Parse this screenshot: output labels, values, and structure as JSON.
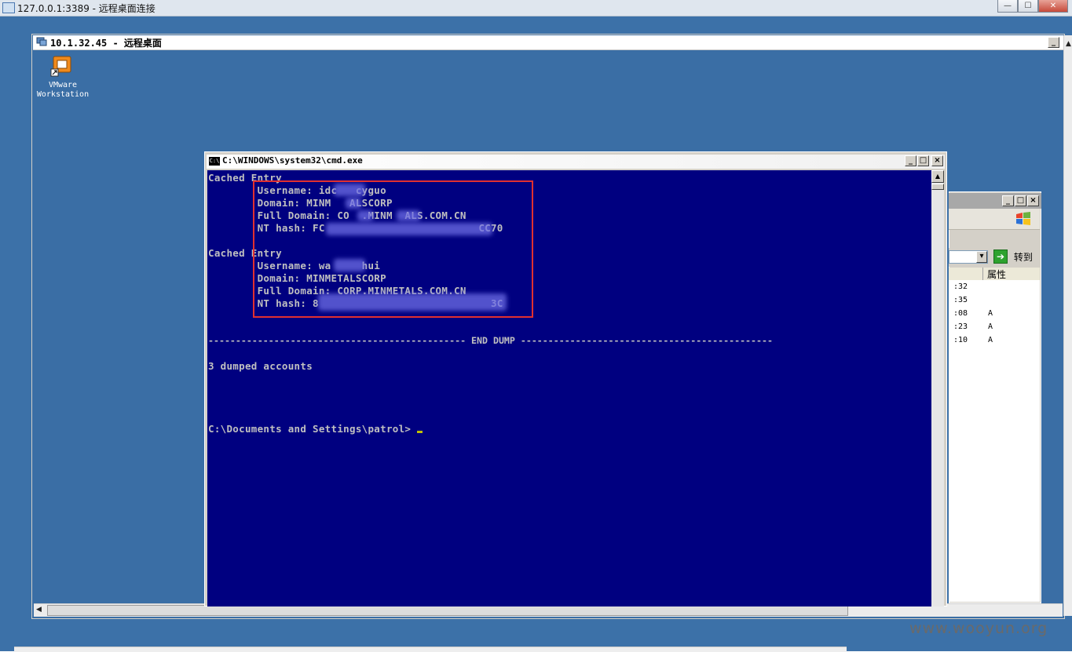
{
  "outer_window": {
    "title": "127.0.0.1:3389 - 远程桌面连接",
    "controls": [
      "—",
      "☐",
      "✕"
    ]
  },
  "rd_window": {
    "title": "10.1.32.45 - 远程桌面"
  },
  "desktop_icon": {
    "label_line1": "VMware",
    "label_line2": "Workstation",
    "icon": "vmware-icon"
  },
  "cmd_window": {
    "title": "C:\\WINDOWS\\system32\\cmd.exe",
    "lines": [
      "Cached Entry",
      "        Username: idc   cyguo",
      "        Domain: MINM   ALSCORP",
      "        Full Domain: CO  .MINM  ALS.COM.CN",
      "        NT hash: FC                         CC70",
      "",
      "Cached Entry",
      "        Username: wa     hui",
      "        Domain: MINMETALSCORP",
      "        Full Domain: CORP.MINMETALS.COM.CN",
      "        NT hash: 8                            3C",
      "",
      "----------------------------------------------- END DUMP ----------------------------------------------",
      "",
      "3 dumped accounts",
      "",
      "",
      "",
      "",
      "C:\\Documents and Settings\\patrol>"
    ]
  },
  "bg_window": {
    "go_button": "转到",
    "column_header": "属性",
    "rows": [
      {
        "time": ":32",
        "attr": ""
      },
      {
        "time": ":35",
        "attr": ""
      },
      {
        "time": ":08",
        "attr": "A"
      },
      {
        "time": ":23",
        "attr": "A"
      },
      {
        "time": ":10",
        "attr": "A"
      }
    ]
  },
  "watermark": "www.wooyun.org"
}
